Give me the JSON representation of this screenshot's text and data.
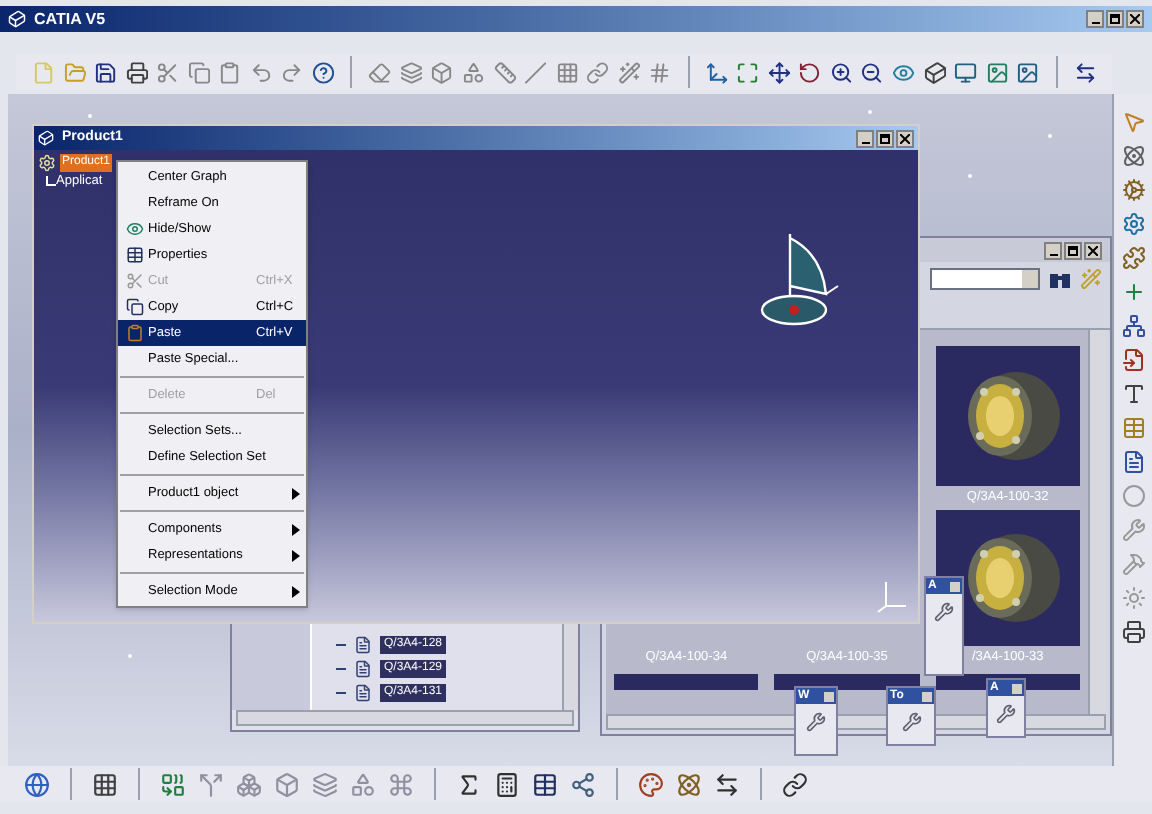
{
  "window": {
    "title": "CATIA V5"
  },
  "product_window": {
    "title": "Product1",
    "tree": [
      {
        "label": "Product1",
        "selected": true,
        "children": [
          {
            "label": "Applicat",
            "selected": false
          }
        ]
      }
    ]
  },
  "context_menu": {
    "groups": [
      [
        {
          "label": "Center Graph",
          "kind": "text",
          "disabled": false,
          "selected": false
        },
        {
          "label": "Reframe On",
          "kind": "text",
          "disabled": false,
          "selected": false
        },
        {
          "label": "Hide/Show",
          "kind": "icon",
          "disabled": false,
          "selected": false
        },
        {
          "label": "Properties",
          "kind": "icon",
          "disabled": false,
          "selected": false
        },
        {
          "label": "Cut",
          "shortcut": "Ctrl+X",
          "kind": "icon",
          "disabled": true,
          "selected": false
        },
        {
          "label": "Copy",
          "shortcut": "Ctrl+C",
          "kind": "icon",
          "disabled": false,
          "selected": false
        },
        {
          "label": "Paste",
          "shortcut": "Ctrl+V",
          "kind": "icon",
          "disabled": false,
          "selected": true
        },
        {
          "label": "Paste Special...",
          "kind": "text",
          "disabled": false,
          "selected": false
        }
      ],
      [
        {
          "label": "Delete",
          "shortcut": "Del",
          "kind": "text",
          "disabled": true,
          "selected": false
        }
      ],
      [
        {
          "label": "Selection Sets...",
          "kind": "text",
          "disabled": false,
          "selected": false
        },
        {
          "label": "Define Selection Set",
          "kind": "text",
          "disabled": false,
          "selected": false
        }
      ],
      [
        {
          "label": "Product1 object",
          "kind": "submenu",
          "disabled": false,
          "selected": false
        }
      ],
      [
        {
          "label": "Components",
          "kind": "submenu",
          "disabled": false,
          "selected": false
        },
        {
          "label": "Representations",
          "kind": "submenu",
          "disabled": false,
          "selected": false
        }
      ],
      [
        {
          "label": "Selection Mode",
          "kind": "submenu",
          "disabled": false,
          "selected": false
        }
      ]
    ]
  },
  "catalog_window": {
    "items": [
      {
        "label": "Q/3A4-100-32",
        "kind": "ring"
      },
      {
        "label": "Q/3A4-100-34",
        "kind": "covered"
      },
      {
        "label": "Q/3A4-100-35",
        "kind": "covered"
      },
      {
        "label": "/3A4-100-33",
        "kind": "ring"
      }
    ]
  },
  "tree_window": {
    "items": [
      {
        "label": "Q/3A4-128",
        "selected": true
      },
      {
        "label": "Q/3A4-129",
        "selected": true
      },
      {
        "label": "Q/3A4-131",
        "selected": true
      }
    ]
  },
  "palettes": [
    {
      "title": "A"
    },
    {
      "title": "W"
    },
    {
      "title": "To"
    },
    {
      "title": "A"
    }
  ]
}
